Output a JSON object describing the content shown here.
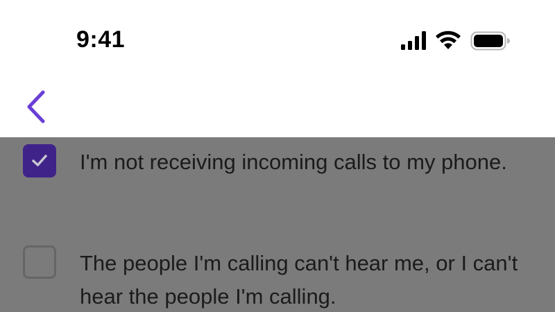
{
  "status_bar": {
    "time": "9:41",
    "icons": [
      "cellular-signal-icon",
      "wifi-icon",
      "battery-icon"
    ]
  },
  "nav": {
    "back_icon": "chevron-left-icon"
  },
  "options": [
    {
      "label": "I'm not receiving incoming calls to my phone.",
      "checked": true
    },
    {
      "label": "The people I'm calling can't hear me, or I can't hear the people I'm calling.",
      "checked": false
    }
  ],
  "colors": {
    "accent": "#6a3fd6",
    "checkbox_checked": "#3f2389",
    "overlay": "#7c7b7c",
    "text": "#1b1b1b"
  }
}
